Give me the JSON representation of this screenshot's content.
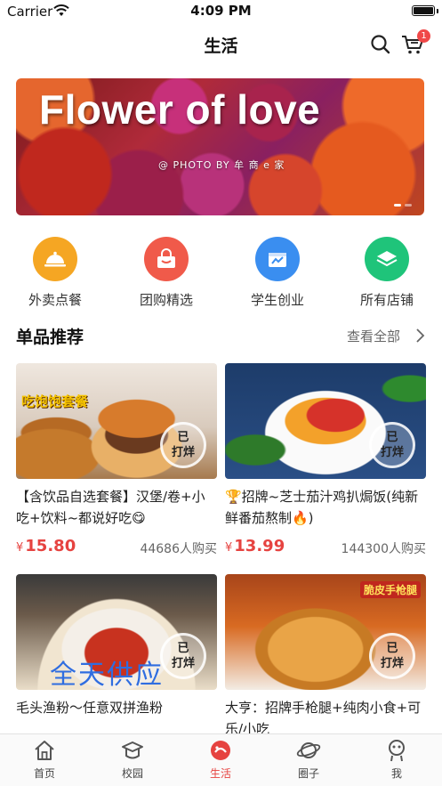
{
  "status_bar": {
    "carrier": "Carrier",
    "time": "4:09 PM"
  },
  "nav": {
    "title": "生活",
    "cart_badge": "1"
  },
  "banner": {
    "title": "Flower of love",
    "credit": "@ PHOTO BY 牟 商 e 家"
  },
  "categories": [
    {
      "label": "外卖点餐",
      "icon": "takeout-dome-icon",
      "color": "#f5a623"
    },
    {
      "label": "团购精选",
      "icon": "shopping-basket-icon",
      "color": "#f05a4a"
    },
    {
      "label": "学生创业",
      "icon": "student-startup-icon",
      "color": "#3a8ef0"
    },
    {
      "label": "所有店铺",
      "icon": "all-stores-layers-icon",
      "color": "#1fc47a"
    }
  ],
  "section": {
    "title": "单品推荐",
    "view_all": "查看全部"
  },
  "products": [
    {
      "name": "【含饮品自选套餐】汉堡/卷+小吃+饮料~都说好吃😋",
      "price": "15.80",
      "currency": "¥",
      "sold": "44686人购买",
      "badge_line1": "已",
      "badge_line2": "打烊",
      "image_text": "吃饱饱套餐"
    },
    {
      "name": "🏆招牌~芝士茄汁鸡扒焗饭(纯新鲜番茄熬制🔥)",
      "price": "13.99",
      "currency": "¥",
      "sold": "144300人购买",
      "badge_line1": "已",
      "badge_line2": "打烊",
      "image_text": ""
    },
    {
      "name": "毛头渔粉～任意双拼渔粉",
      "price": "",
      "currency": "",
      "sold": "",
      "badge_line1": "已",
      "badge_line2": "打烊",
      "image_text": "全天供应"
    },
    {
      "name": "大亨：招牌手枪腿+纯肉小食+可乐/小吃",
      "price": "",
      "currency": "",
      "sold": "",
      "badge_line1": "已",
      "badge_line2": "打烊",
      "image_text": "脆皮手枪腿"
    }
  ],
  "tab_bar": {
    "items": [
      {
        "label": "首页",
        "icon": "home-icon",
        "active": false
      },
      {
        "label": "校园",
        "icon": "campus-cap-icon",
        "active": false
      },
      {
        "label": "生活",
        "icon": "life-icon",
        "active": true
      },
      {
        "label": "圈子",
        "icon": "planet-icon",
        "active": false
      },
      {
        "label": "我",
        "icon": "profile-icon",
        "active": false
      }
    ]
  },
  "colors": {
    "accent": "#e64340",
    "badge": "#f04848"
  }
}
